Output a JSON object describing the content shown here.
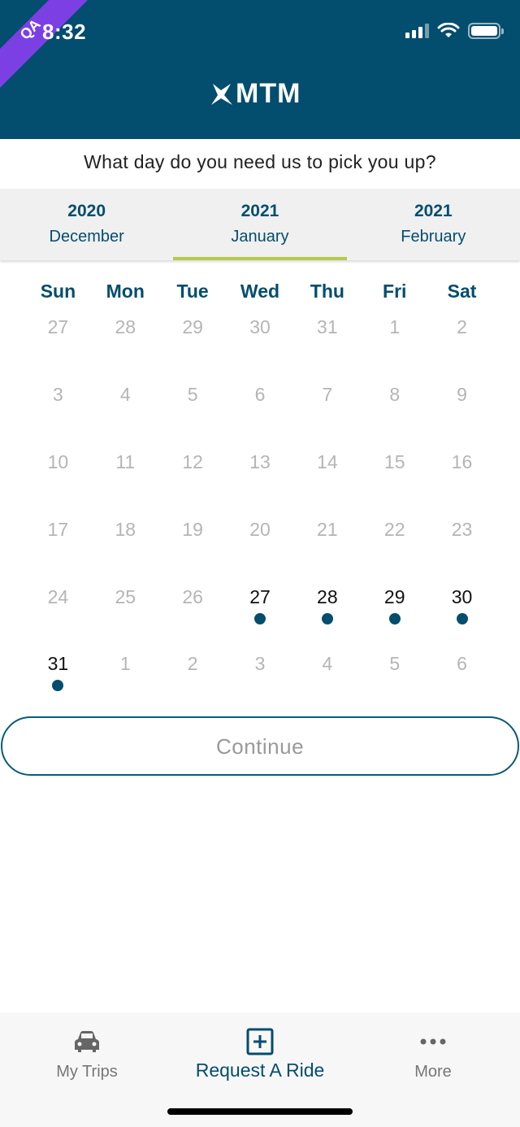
{
  "status_bar": {
    "time": "8:32",
    "qa_badge": "QA"
  },
  "header": {
    "logo_text": "MTM"
  },
  "prompt": "What day do you need us to pick you up?",
  "month_tabs": [
    {
      "year": "2020",
      "month": "December",
      "active": false
    },
    {
      "year": "2021",
      "month": "January",
      "active": true
    },
    {
      "year": "2021",
      "month": "February",
      "active": false
    }
  ],
  "weekdays": [
    "Sun",
    "Mon",
    "Tue",
    "Wed",
    "Thu",
    "Fri",
    "Sat"
  ],
  "days": [
    {
      "n": "27",
      "state": "disabled"
    },
    {
      "n": "28",
      "state": "disabled"
    },
    {
      "n": "29",
      "state": "disabled"
    },
    {
      "n": "30",
      "state": "disabled"
    },
    {
      "n": "31",
      "state": "disabled"
    },
    {
      "n": "1",
      "state": "disabled"
    },
    {
      "n": "2",
      "state": "disabled"
    },
    {
      "n": "3",
      "state": "disabled"
    },
    {
      "n": "4",
      "state": "disabled"
    },
    {
      "n": "5",
      "state": "disabled"
    },
    {
      "n": "6",
      "state": "disabled"
    },
    {
      "n": "7",
      "state": "disabled"
    },
    {
      "n": "8",
      "state": "disabled"
    },
    {
      "n": "9",
      "state": "disabled"
    },
    {
      "n": "10",
      "state": "disabled"
    },
    {
      "n": "11",
      "state": "disabled"
    },
    {
      "n": "12",
      "state": "disabled"
    },
    {
      "n": "13",
      "state": "disabled"
    },
    {
      "n": "14",
      "state": "disabled"
    },
    {
      "n": "15",
      "state": "disabled"
    },
    {
      "n": "16",
      "state": "disabled"
    },
    {
      "n": "17",
      "state": "disabled"
    },
    {
      "n": "18",
      "state": "disabled"
    },
    {
      "n": "19",
      "state": "disabled"
    },
    {
      "n": "20",
      "state": "disabled"
    },
    {
      "n": "21",
      "state": "disabled"
    },
    {
      "n": "22",
      "state": "disabled"
    },
    {
      "n": "23",
      "state": "disabled"
    },
    {
      "n": "24",
      "state": "disabled"
    },
    {
      "n": "25",
      "state": "disabled"
    },
    {
      "n": "26",
      "state": "disabled"
    },
    {
      "n": "27",
      "state": "selected",
      "dot": true
    },
    {
      "n": "28",
      "state": "available",
      "dot": true
    },
    {
      "n": "29",
      "state": "available",
      "dot": true
    },
    {
      "n": "30",
      "state": "available",
      "dot": true
    },
    {
      "n": "31",
      "state": "available",
      "dot": true
    },
    {
      "n": "1",
      "state": "disabled"
    },
    {
      "n": "2",
      "state": "disabled"
    },
    {
      "n": "3",
      "state": "disabled"
    },
    {
      "n": "4",
      "state": "disabled"
    },
    {
      "n": "5",
      "state": "disabled"
    },
    {
      "n": "6",
      "state": "disabled"
    }
  ],
  "continue_label": "Continue",
  "bottom_nav": [
    {
      "label": "My Trips",
      "icon": "car-icon",
      "active": false
    },
    {
      "label": "Request A Ride",
      "icon": "plus-square-icon",
      "active": true
    },
    {
      "label": "More",
      "icon": "more-dots-icon",
      "active": false
    }
  ],
  "colors": {
    "brand": "#034d6e",
    "accent": "#b5cc4a",
    "qa": "#7b3fe4"
  }
}
